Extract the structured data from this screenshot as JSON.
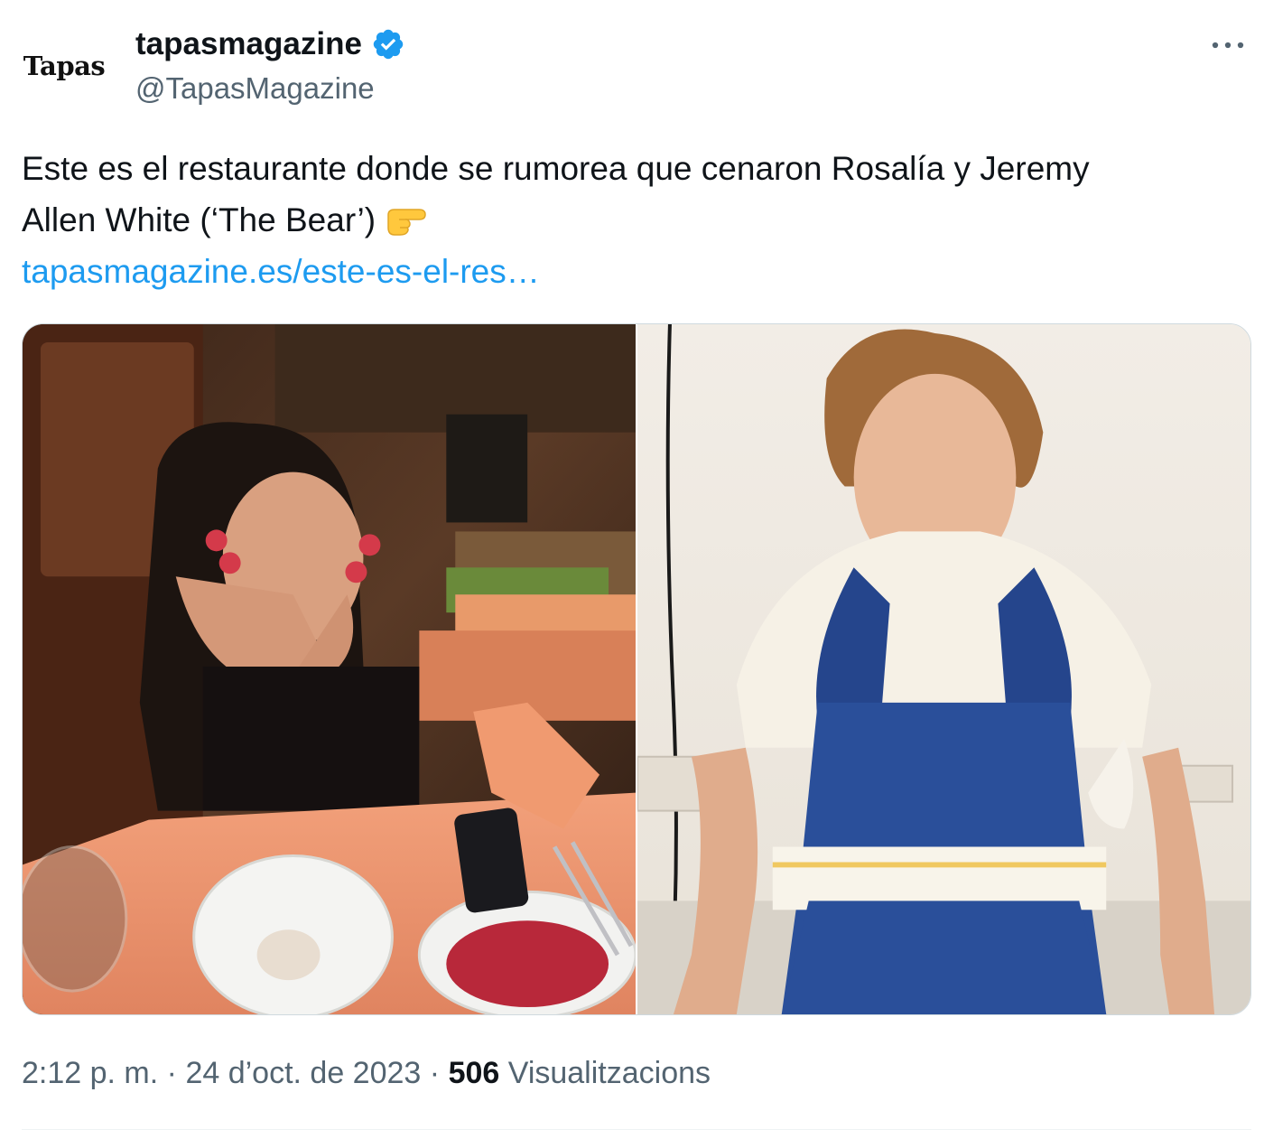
{
  "author": {
    "avatar_text": "Tapas",
    "display_name": "tapasmagazine",
    "handle": "@TapasMagazine",
    "verified": true,
    "verified_color": "#1d9bf0"
  },
  "tweet": {
    "text_line1": "Este es el restaurante donde se rumorea que cenaron Rosalía y Jeremy",
    "text_line2": "Allen White (‘The Bear’)",
    "emoji": "backhand-index-pointing-right-icon",
    "link_text": "tapasmagazine.es/este-es-el-res…",
    "link_color": "#1d9bf0"
  },
  "media": {
    "photos": [
      {
        "name": "restaurant-photo",
        "icon": "photo-woman-restaurant"
      },
      {
        "name": "chef-photo",
        "icon": "photo-man-apron"
      }
    ]
  },
  "meta": {
    "time": "2:12 p. m.",
    "separator": "·",
    "date": "24 d’oct. de 2023",
    "views_count": "506",
    "views_label": "Visualitzacions"
  },
  "colors": {
    "text_primary": "#0f1419",
    "text_secondary": "#536471",
    "border": "#cfd9de"
  }
}
